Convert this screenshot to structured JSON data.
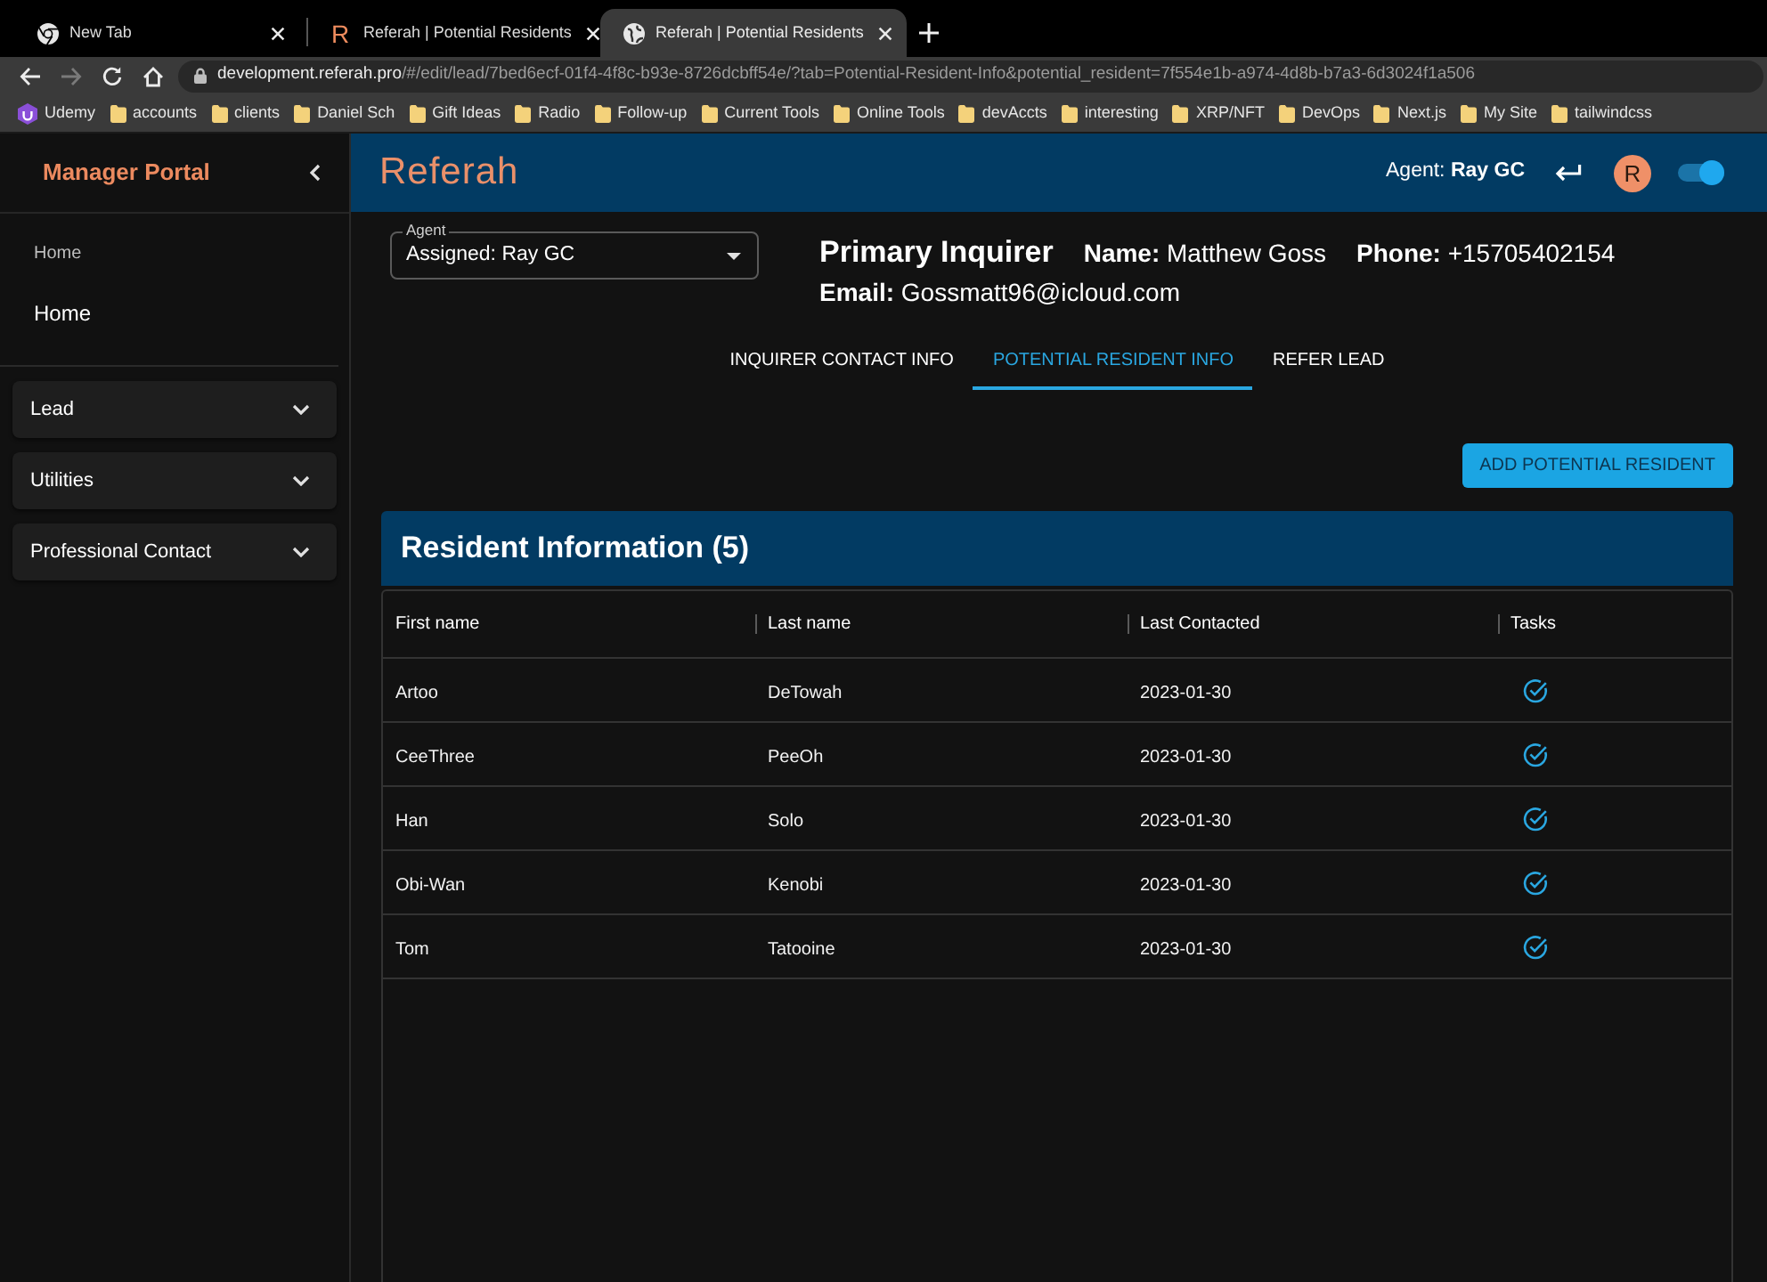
{
  "browser": {
    "tabs": [
      {
        "kind": "logo",
        "title": "New Tab",
        "selected": false
      },
      {
        "kind": "letter",
        "favicon": "R",
        "title": "Referah | Potential Residents",
        "selected": false
      },
      {
        "kind": "globe",
        "title": "Referah | Potential Residents",
        "selected": true
      }
    ],
    "nav_buttons": [
      {
        "kind": "back",
        "disabled": false
      },
      {
        "kind": "forward",
        "disabled": true
      },
      {
        "kind": "reload",
        "disabled": false
      },
      {
        "kind": "home",
        "disabled": false
      }
    ],
    "address_bar": {
      "host": "development.referah.pro",
      "path": "/#/edit/lead/7bed6ecf-01f4-4f8c-b93e-8726dcbff54e/?tab=Potential-Resident-Info&potential_resident=7f554e1b-a974-4d8b-b7a3-6d3024f1a506"
    },
    "bookmarks": [
      {
        "kind": "site",
        "label": "Udemy"
      },
      {
        "kind": "folder",
        "label": "accounts"
      },
      {
        "kind": "folder",
        "label": "clients"
      },
      {
        "kind": "folder",
        "label": "Daniel Sch"
      },
      {
        "kind": "folder",
        "label": "Gift Ideas"
      },
      {
        "kind": "folder",
        "label": "Radio"
      },
      {
        "kind": "folder",
        "label": "Follow-up"
      },
      {
        "kind": "folder",
        "label": "Current Tools"
      },
      {
        "kind": "folder",
        "label": "Online Tools"
      },
      {
        "kind": "folder",
        "label": "devAccts"
      },
      {
        "kind": "folder",
        "label": "interesting"
      },
      {
        "kind": "folder",
        "label": "XRP/NFT"
      },
      {
        "kind": "folder",
        "label": "DevOps"
      },
      {
        "kind": "folder",
        "label": "Next.js"
      },
      {
        "kind": "folder",
        "label": "My Site"
      },
      {
        "kind": "folder",
        "label": "tailwindcss"
      }
    ]
  },
  "sidebar": {
    "title": "Manager Portal",
    "breadcrumb": "Home",
    "nav_item": "Home",
    "sections": [
      {
        "label": "Lead",
        "expanded": false
      },
      {
        "label": "Utilities",
        "expanded": false
      },
      {
        "label": "Professional Contact",
        "expanded": false
      }
    ]
  },
  "header": {
    "logo": "Referah",
    "agent": "Agent: **Ray GC**",
    "avatar": "R",
    "theme_toggle": {
      "on": true
    }
  },
  "agent_select": {
    "label": "Agent",
    "value": "Assigned: Ray GC"
  },
  "inquirer": {
    "title": "Primary Inquirer",
    "fields": [
      {
        "label": "Name:",
        "value": "Matthew Goss"
      },
      {
        "label": "Phone:",
        "value": "+15705402154"
      },
      {
        "label": "Email:",
        "value": "Gossmatt96@icloud.com"
      }
    ]
  },
  "tabs": [
    {
      "label": "INQUIRER CONTACT INFO",
      "selected": false
    },
    {
      "label": "POTENTIAL RESIDENT INFO",
      "selected": true
    },
    {
      "label": "REFER LEAD",
      "selected": false
    }
  ],
  "add_button": "ADD POTENTIAL RESIDENT",
  "residents": {
    "title": "Resident Information (5)",
    "columns": [
      "First name",
      "Last name",
      "Last Contacted",
      "Tasks"
    ],
    "rows": [
      [
        "Artoo",
        "DeTowah",
        "2023-01-30"
      ],
      [
        "CeeThree",
        "PeeOh",
        "2023-01-30"
      ],
      [
        "Han",
        "Solo",
        "2023-01-30"
      ],
      [
        "Obi-Wan",
        "Kenobi",
        "2023-01-30"
      ],
      [
        "Tom",
        "Tatooine",
        "2023-01-30"
      ]
    ]
  }
}
